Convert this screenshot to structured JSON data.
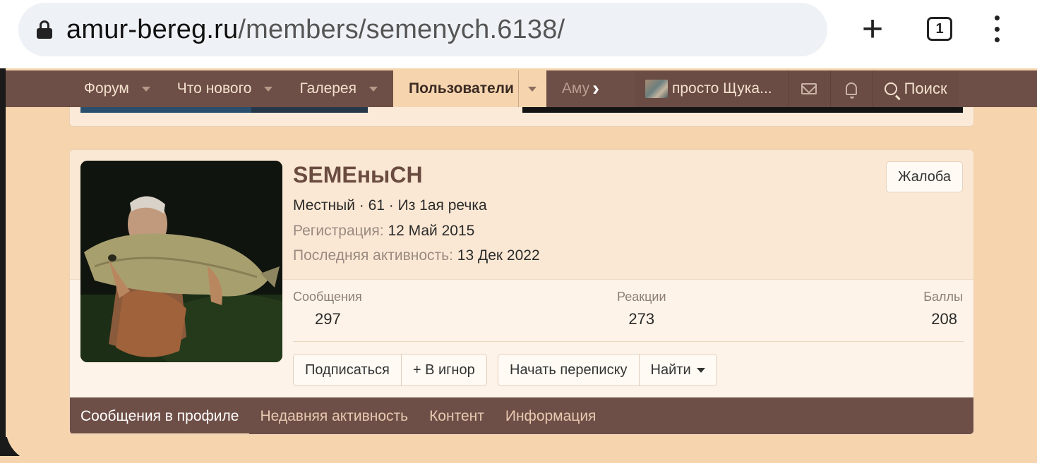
{
  "browser": {
    "url_host": "amur-bereg.ru",
    "url_path": "/members/semenych.6138/",
    "tab_count": "1"
  },
  "nav": {
    "items": [
      {
        "label": "Форум"
      },
      {
        "label": "Что нового"
      },
      {
        "label": "Галерея"
      },
      {
        "label": "Пользователи"
      },
      {
        "label": "Аму"
      }
    ],
    "user_name": "просто Щука...",
    "search_label": "Поиск"
  },
  "profile": {
    "name": "SEMEныCH",
    "title_line": "Местный · 61 · Из 1ая речка",
    "registration_label": "Регистрация:",
    "registration_value": "12 Май 2015",
    "last_activity_label": "Последняя активность:",
    "last_activity_value": "13 Дек 2022",
    "report_label": "Жалоба"
  },
  "stats": [
    {
      "label": "Сообщения",
      "value": "297"
    },
    {
      "label": "Реакции",
      "value": "273"
    },
    {
      "label": "Баллы",
      "value": "208"
    }
  ],
  "actions": {
    "follow": "Подписаться",
    "ignore": "+ В игнор",
    "start_conversation": "Начать переписку",
    "find": "Найти"
  },
  "tabs": [
    {
      "label": "Сообщения в профиле"
    },
    {
      "label": "Недавняя активность"
    },
    {
      "label": "Контент"
    },
    {
      "label": "Информация"
    }
  ],
  "colors": {
    "page_bg": "#f6d5ae",
    "nav_bg": "#6e4f47",
    "active_nav": "#f6d5ae",
    "name_color": "#6a4b40"
  }
}
